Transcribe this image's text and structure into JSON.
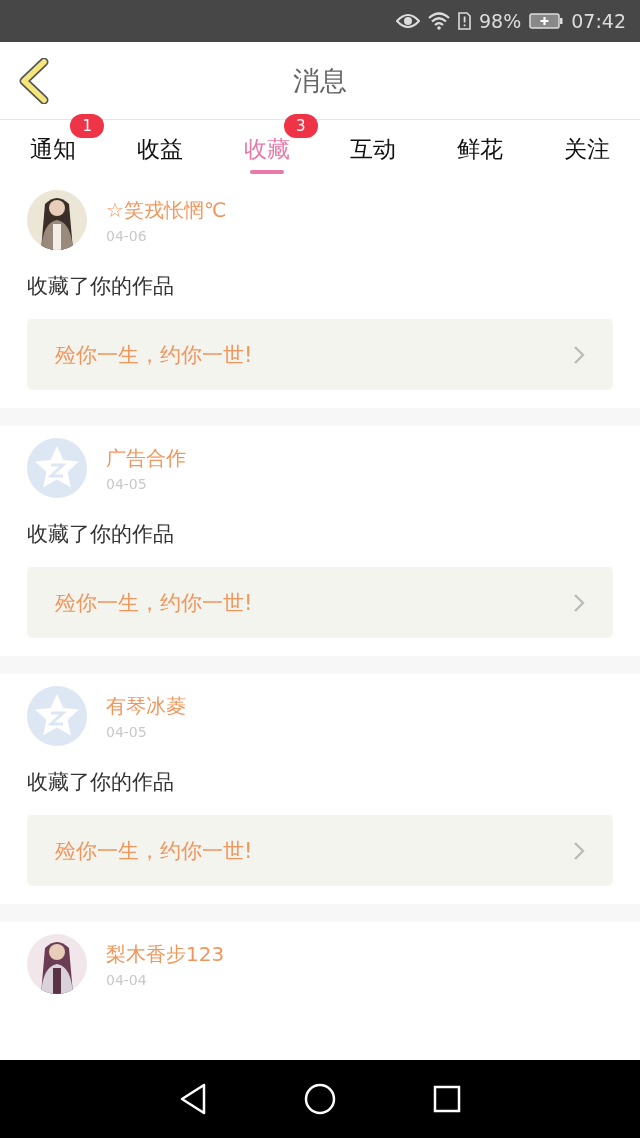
{
  "status_bar": {
    "battery": "98%",
    "time": "07:42"
  },
  "header": {
    "title": "消息"
  },
  "tabs": [
    {
      "label": "通知",
      "selected": false,
      "badge": "1"
    },
    {
      "label": "收益",
      "selected": false
    },
    {
      "label": "收藏",
      "selected": true,
      "badge": "3"
    },
    {
      "label": "互动",
      "selected": false
    },
    {
      "label": "鲜花",
      "selected": false
    },
    {
      "label": "关注",
      "selected": false
    }
  ],
  "messages": [
    {
      "name": "☆笑戎怅惘℃",
      "date": "04-06",
      "action": "收藏了你的作品",
      "work_title": "殓你一生，约你一世!"
    },
    {
      "avatar": {
        "kind": "default"
      },
      "name": "广告合作",
      "date": "04-05",
      "action": "收藏了你的作品",
      "work_title": "殓你一生，约你一世!"
    },
    {
      "avatar": {
        "kind": "default"
      },
      "name": "有琴冰菱",
      "date": "04-05",
      "action": "收藏了你的作品",
      "work_title": "殓你一生，约你一世!"
    },
    {
      "name": "梨木香步123",
      "date": "04-04"
    }
  ]
}
